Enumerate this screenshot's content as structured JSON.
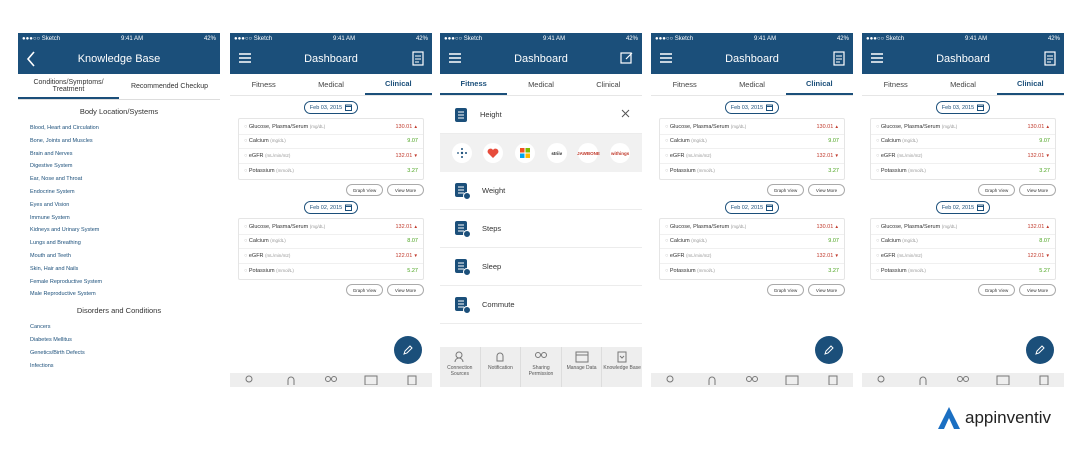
{
  "status": {
    "carrier": "●●●○○ Sketch",
    "time": "9:41 AM",
    "battery": "42%"
  },
  "kb": {
    "title": "Knowledge Base",
    "tabs": [
      "Conditions/Symptoms/ Treatment",
      "Recommended Checkup"
    ],
    "section1": "Body Location/Systems",
    "items1": [
      "Blood, Heart and Circulation",
      "Bone, Joints and Muscles",
      "Brain and Nerves",
      "Digestive System",
      "Ear, Nose and Throat",
      "Endocrine System",
      "Eyes and Vision",
      "Immune System",
      "Kidneys and Urinary System",
      "Lungs and Breathing",
      "Mouth and Teeth",
      "Skin, Hair and Nails",
      "Female Reproductive System",
      "Male Reproductive System"
    ],
    "section2": "Disorders and Conditions",
    "items2": [
      "Cancers",
      "Diabetes Mellitus",
      "Genetics/Birth Defects",
      "Infections"
    ]
  },
  "dash": {
    "title": "Dashboard",
    "tabs": [
      "Fitness",
      "Medical",
      "Clinical"
    ],
    "graph_view": "Graph View",
    "view_more": "View More",
    "date1": "Feb 03, 2015",
    "date2": "Feb 02, 2015",
    "set1": [
      {
        "name": "Glucose, Plasma/Serum",
        "unit": "(mg/dL)",
        "value": "130.01",
        "trend": "up",
        "color": "red"
      },
      {
        "name": "Calcium",
        "unit": "(mg/dL)",
        "value": "9.07",
        "trend": "",
        "color": "green"
      },
      {
        "name": "eGFR",
        "unit": "(mL/min/m2)",
        "value": "132.01",
        "trend": "down",
        "color": "red"
      },
      {
        "name": "Potassium",
        "unit": "(mmol/L)",
        "value": "3.27",
        "trend": "",
        "color": "green"
      }
    ],
    "set2": [
      {
        "name": "Glucose, Plasma/Serum",
        "unit": "(mg/dL)",
        "value": "132.01",
        "trend": "up",
        "color": "red"
      },
      {
        "name": "Calcium",
        "unit": "(mg/dL)",
        "value": "8.07",
        "trend": "",
        "color": "green"
      },
      {
        "name": "eGFR",
        "unit": "(mL/min/m2)",
        "value": "122.01",
        "trend": "down",
        "color": "red"
      },
      {
        "name": "Potassium",
        "unit": "(mmol/L)",
        "value": "5.27",
        "trend": "",
        "color": "green"
      }
    ]
  },
  "sources": {
    "height": "Height",
    "logos": [
      "fitbit",
      "heart",
      "microsoft",
      "striiv",
      "jawbone",
      "withings"
    ],
    "logo_text": {
      "striiv": "striiv",
      "jawbone": "JAWBONE",
      "withings": "withings"
    },
    "items": [
      "Weight",
      "Steps",
      "Sleep",
      "Commute"
    ],
    "bottom": [
      "Connection Sources",
      "Notification",
      "Sharing Permission",
      "Manage Data",
      "Knowledge Base"
    ]
  },
  "brand": "appinventiv",
  "colors": {
    "primary": "#1b4f7a",
    "red": "#c0392b",
    "green": "#4aa31e"
  }
}
